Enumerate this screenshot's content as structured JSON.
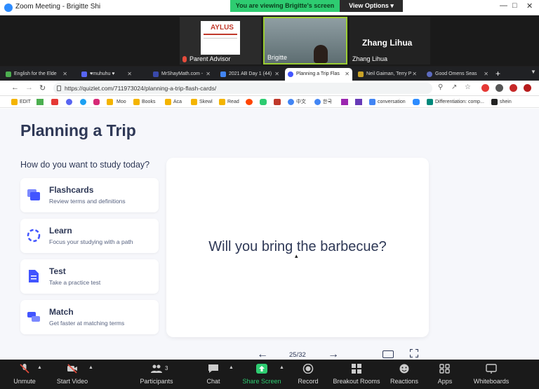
{
  "zoom": {
    "window_title": "Zoom Meeting - Brigitte Shi",
    "share_banner": "You are viewing Brigitte's screen",
    "view_options": "View Options",
    "participants": [
      {
        "name": "Parent Advisor",
        "logo_text": "AYLUS"
      },
      {
        "name": "Brigitte"
      },
      {
        "name": "Zhang Lihua",
        "display": "Zhang Lihua"
      }
    ],
    "toolbar": {
      "unmute": "Unmute",
      "start_video": "Start Video",
      "participants": "Participants",
      "participants_count": "3",
      "chat": "Chat",
      "share_screen": "Share Screen",
      "record": "Record",
      "breakout_rooms": "Breakout Rooms",
      "reactions": "Reactions",
      "apps": "Apps",
      "whiteboards": "Whiteboards"
    }
  },
  "browser": {
    "tabs": [
      {
        "label": "English for the Elde",
        "color": "#4caf50"
      },
      {
        "label": "♥muhuhu ♥",
        "color": "#5865f2"
      },
      {
        "label": "MrShayMath.com -",
        "color": "#3949ab"
      },
      {
        "label": "2021 AB Day 1 (44)",
        "color": "#4285f4"
      },
      {
        "label": "Planning a Trip Flas",
        "color": "#4255ff"
      },
      {
        "label": "Neil Gaiman, Terry P",
        "color": "#c9a227"
      },
      {
        "label": "Good Omens Seas",
        "color": "#5c6bc0"
      }
    ],
    "url": "https://quizlet.com/711973024/planning-a-trip-flash-cards/",
    "bookmarks": [
      "EDIT",
      "Moo",
      "Books",
      "Aca",
      "Skewl",
      "Read",
      "中文",
      "한국",
      "conversation",
      "Differentiation: comp...",
      "shein"
    ]
  },
  "quizlet": {
    "title": "Planning a Trip",
    "prompt": "How do you want to study today?",
    "modes": [
      {
        "name": "Flashcards",
        "desc": "Review terms and definitions",
        "icon": "flashcards-icon"
      },
      {
        "name": "Learn",
        "desc": "Focus your studying with a path",
        "icon": "learn-icon"
      },
      {
        "name": "Test",
        "desc": "Take a practice test",
        "icon": "test-icon"
      },
      {
        "name": "Match",
        "desc": "Get faster at matching terms",
        "icon": "match-icon"
      }
    ],
    "card_term": "Will you bring the barbecue?",
    "counter": "25/32"
  }
}
